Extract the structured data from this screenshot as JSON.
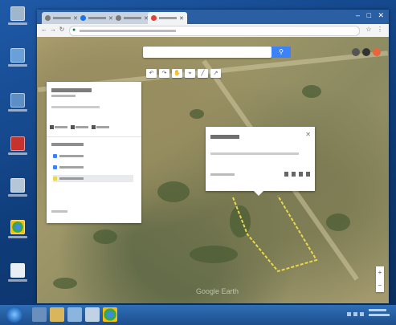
{
  "desktop": {
    "icons": [
      {
        "name": "recycle-bin"
      },
      {
        "name": "computer"
      },
      {
        "name": "network"
      },
      {
        "name": "app-red"
      },
      {
        "name": "documents"
      },
      {
        "name": "chrome"
      },
      {
        "name": "file"
      }
    ]
  },
  "browser": {
    "tabs": [
      {
        "name": "tab-1"
      },
      {
        "name": "tab-2"
      },
      {
        "name": "tab-3"
      },
      {
        "name": "tab-4-active"
      }
    ],
    "window_controls": {
      "minimize": "–",
      "maximize": "□",
      "close": "✕"
    },
    "nav": {
      "back": "←",
      "forward": "→",
      "reload": "↻"
    },
    "map": {
      "search_button_icon": "search-icon",
      "watermark": "Google Earth",
      "zoom_in": "+",
      "zoom_out": "−"
    }
  },
  "colors": {
    "polygon": "#e8d84a",
    "accent": "#3e82f7",
    "taskbar": "#1c4f8e"
  }
}
